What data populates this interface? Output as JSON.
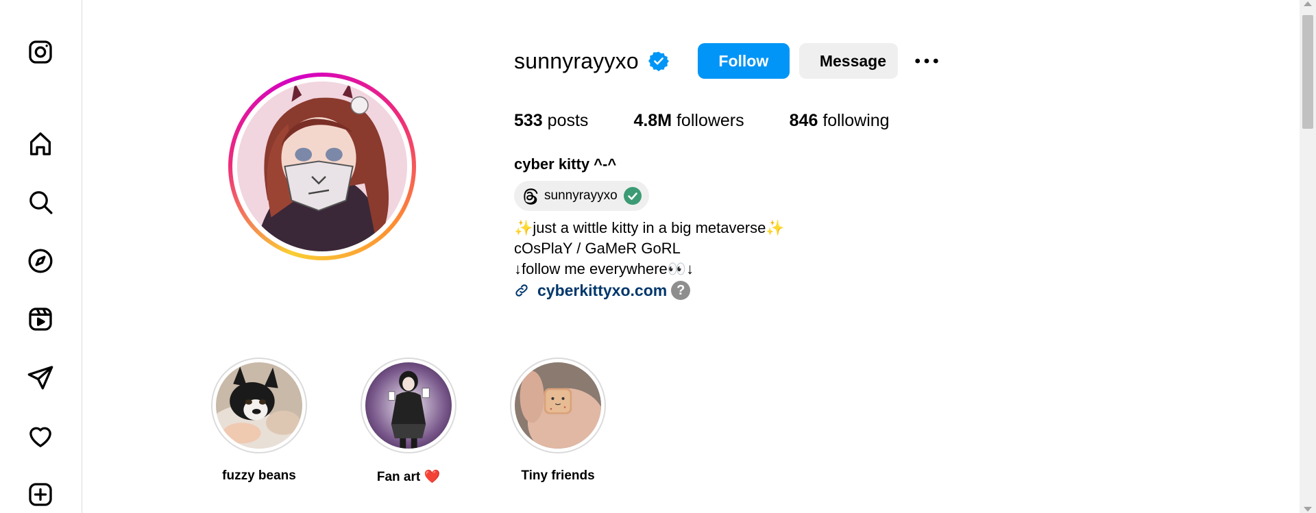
{
  "sidebar": {
    "items": [
      {
        "name": "instagram-logo-icon"
      },
      {
        "name": "home-icon"
      },
      {
        "name": "search-icon"
      },
      {
        "name": "explore-icon"
      },
      {
        "name": "reels-icon"
      },
      {
        "name": "direct-messages-icon"
      },
      {
        "name": "notifications-heart-icon"
      },
      {
        "name": "create-icon"
      }
    ]
  },
  "profile": {
    "username": "sunnyrayyxo",
    "follow_label": "Follow",
    "message_label": "Message",
    "stats": {
      "posts_count": "533",
      "posts_label": "posts",
      "followers_count": "4.8M",
      "followers_label": "followers",
      "following_count": "846",
      "following_label": "following"
    },
    "full_name": "cyber kitty ^-^",
    "threads_handle": "sunnyrayyxo",
    "bio": {
      "line1": "✨just a wittle kitty in a big metaverse✨",
      "line2": "cOsPlaY / GaMeR GoRL",
      "line3": "↓follow me everywhere👀↓"
    },
    "link": "cyberkittyxo.com",
    "help_badge": "?"
  },
  "highlights": [
    {
      "label": "fuzzy beans"
    },
    {
      "label": "Fan art ❤️"
    },
    {
      "label": "Tiny friends"
    }
  ],
  "colors": {
    "follow_button": "#0095f6",
    "verified_badge": "#0095f6",
    "link": "#00376b",
    "secondary_button": "#efefef",
    "threads_check": "#3c9b74"
  }
}
